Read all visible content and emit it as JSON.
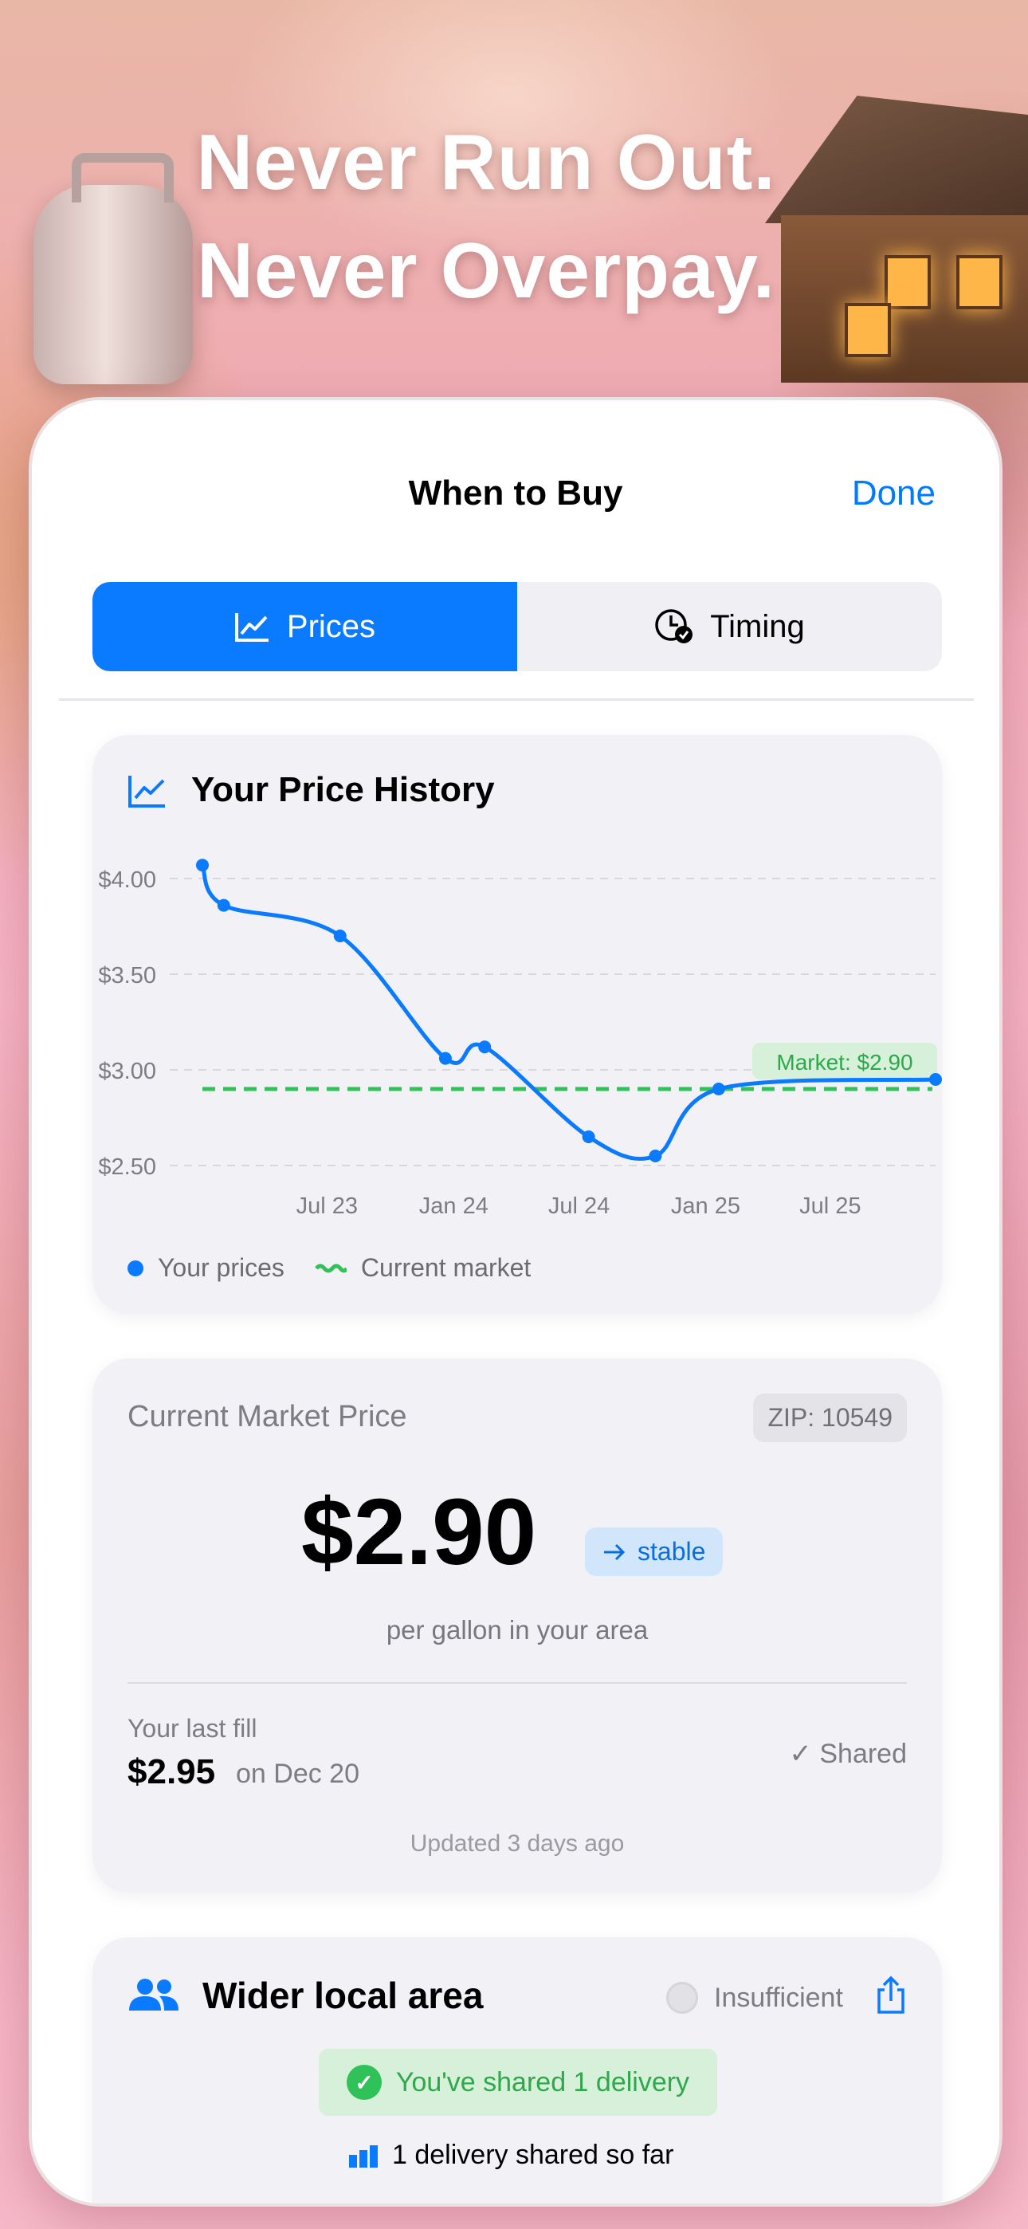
{
  "headline": {
    "line1": "Never Run Out.",
    "line2": "Never Overpay."
  },
  "nav": {
    "title": "When to Buy",
    "done_label": "Done"
  },
  "segmented": {
    "tabs": [
      {
        "label": "Prices",
        "icon": "chart-line-icon",
        "active": true
      },
      {
        "label": "Timing",
        "icon": "clock-check-icon",
        "active": false
      }
    ]
  },
  "price_history": {
    "title": "Your Price History",
    "market_label": "Market: $2.90",
    "legend": {
      "your_prices": "Your prices",
      "current_market": "Current market"
    }
  },
  "chart_data": {
    "type": "line",
    "y_ticks": [
      "$4.00",
      "$3.50",
      "$3.00",
      "$2.50"
    ],
    "x_ticks": [
      "Jul 23",
      "Jan 24",
      "Jul 24",
      "Jan 25",
      "Jul 25"
    ],
    "ylim": [
      2.4,
      4.1
    ],
    "xlim": [
      "2023-01-01",
      "2025-12-01"
    ],
    "grid": true,
    "legend_position": "bottom-left",
    "series": [
      {
        "name": "Your prices",
        "color": "#0a7aff",
        "points": [
          {
            "x": "2023-01-01",
            "y": 4.07
          },
          {
            "x": "2023-02-01",
            "y": 3.86
          },
          {
            "x": "2023-07-20",
            "y": 3.7
          },
          {
            "x": "2023-12-20",
            "y": 3.06
          },
          {
            "x": "2024-02-15",
            "y": 3.12
          },
          {
            "x": "2024-07-15",
            "y": 2.65
          },
          {
            "x": "2024-10-20",
            "y": 2.55
          },
          {
            "x": "2025-01-20",
            "y": 2.9
          },
          {
            "x": "2025-12-01",
            "y": 2.95
          }
        ]
      },
      {
        "name": "Current market",
        "color": "#30c158",
        "constant": 2.9
      }
    ]
  },
  "market_price": {
    "label": "Current Market Price",
    "zip": "ZIP: 10549",
    "price": "$2.90",
    "trend": "stable",
    "per_unit": "per gallon in your area",
    "last_fill_label": "Your last fill",
    "last_fill_price": "$2.95",
    "last_fill_date": "on Dec 20",
    "shared_status": "✓ Shared",
    "updated": "Updated 3 days ago"
  },
  "wider_area": {
    "title": "Wider local area",
    "status": "Insufficient",
    "shared_pill": "You've shared 1 delivery",
    "so_far": "1 delivery shared so far"
  },
  "colors": {
    "accent": "#0a7aff",
    "market_green": "#30c158",
    "card_bg": "#f2f1f6"
  }
}
